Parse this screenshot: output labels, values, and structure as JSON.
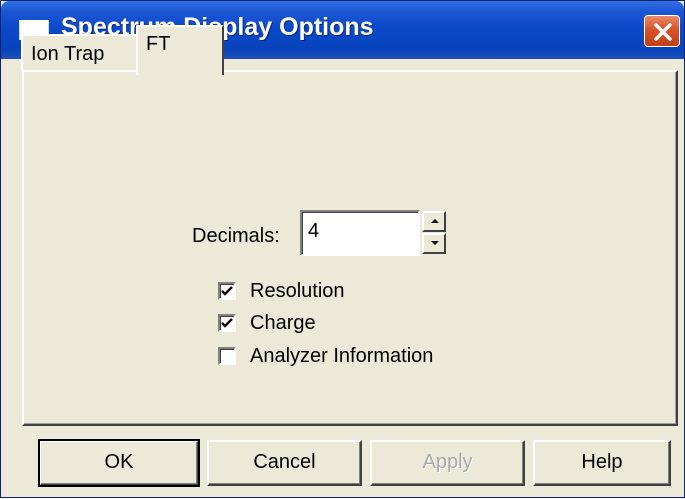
{
  "window": {
    "title": "Spectrum Display Options"
  },
  "tabs": [
    {
      "label": "Ion Trap",
      "selected": false
    },
    {
      "label": "FT",
      "selected": true
    }
  ],
  "decimals": {
    "label": "Decimals:",
    "value": "4"
  },
  "options": [
    {
      "label": "Resolution",
      "checked": true
    },
    {
      "label": "Charge",
      "checked": true
    },
    {
      "label": "Analyzer Information",
      "checked": false
    }
  ],
  "buttons": {
    "ok": "OK",
    "cancel": "Cancel",
    "apply": "Apply",
    "help": "Help"
  },
  "colors": {
    "titlebar": "#0a48c8",
    "dialog": "#ece9d8",
    "close": "#d8532a"
  },
  "icons": {
    "window": "window-icon",
    "close": "close-icon",
    "spin_up": "arrow-up-icon",
    "spin_down": "arrow-down-icon",
    "check": "checkmark-icon"
  }
}
